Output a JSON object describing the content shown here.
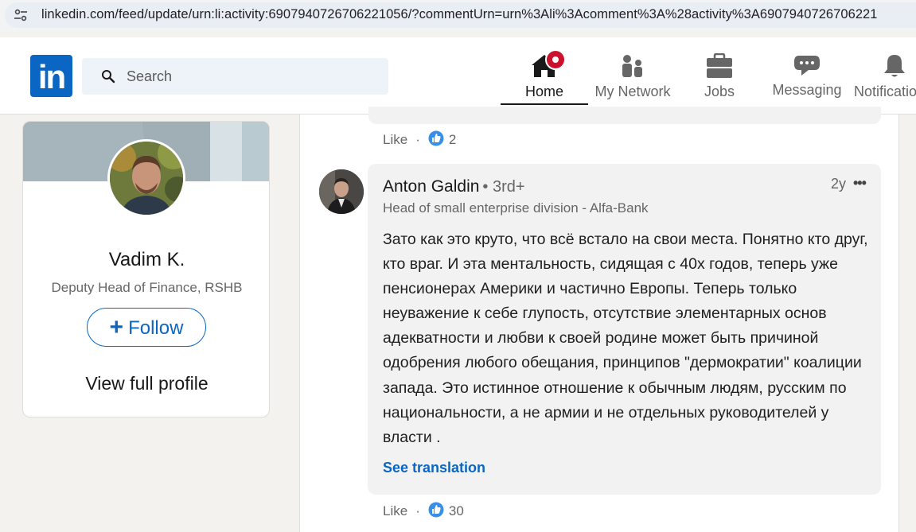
{
  "browser": {
    "url": "linkedin.com/feed/update/urn:li:activity:6907940726706221056/?commentUrn=urn%3Ali%3Acomment%3A%28activity%3A6907940726706221"
  },
  "nav": {
    "logo": "in",
    "search_placeholder": "Search",
    "items": [
      {
        "label": "Home",
        "icon": "home-icon"
      },
      {
        "label": "My Network",
        "icon": "network-icon"
      },
      {
        "label": "Jobs",
        "icon": "briefcase-icon"
      },
      {
        "label": "Messaging",
        "icon": "messaging-icon"
      },
      {
        "label": "Notifications",
        "icon": "bell-icon"
      }
    ]
  },
  "profile": {
    "name": "Vadim K.",
    "title": "Deputy Head of Finance, RSHB",
    "follow_label": "Follow",
    "view_profile_label": "View full profile"
  },
  "prev_comment": {
    "like_label": "Like",
    "separator": "·",
    "reaction_count": "2"
  },
  "comment": {
    "author": "Anton Galdin",
    "degree": "• 3rd+",
    "headline": "Head of small enterprise division - Alfa-Bank",
    "time": "2y",
    "more": "•••",
    "text": "Зато как это круто, что всё встало на свои места. Понятно кто друг, кто враг. И эта ментальность, сидящая с 40х годов, теперь уже пенсионерах Америки и частично Европы. Теперь только неуважение к себе глупость, отсутствие элементарных основ адекватности и любви к своей родине может быть причиной одобрения любого обещания, принципов \"дермократии\" коалиции запада. Это истинное отношение к обычным людям, русским по национальности, а не армии и не отдельных руководителей у власти .",
    "see_translation": "See translation",
    "like_label": "Like",
    "separator": "·",
    "reaction_count": "30"
  },
  "colors": {
    "brand": "#0a66c2",
    "notification_badge": "#cb112d",
    "bubble": "#f2f2f2",
    "page_bg": "#f4f2ee"
  }
}
